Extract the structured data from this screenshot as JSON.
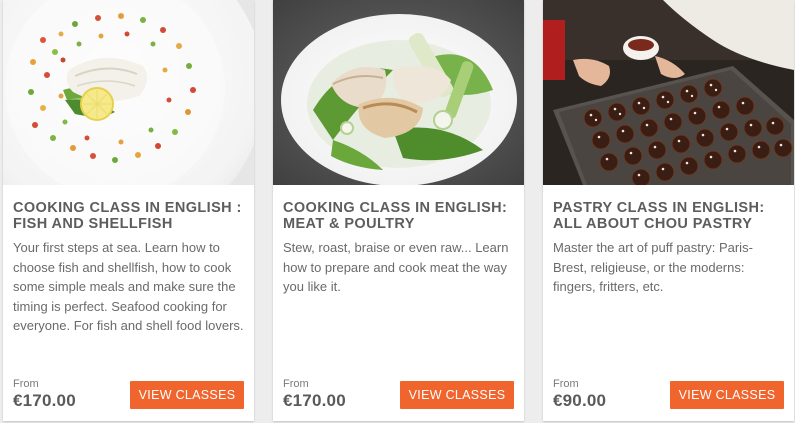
{
  "cards": [
    {
      "image_icon": "fish-dish-photo",
      "title_line1": "COOKING CLASS IN ENGLISH :",
      "title_line2": "FISH AND SHELLFISH",
      "description": "Your first steps at sea. Learn how to choose fish and shellfish, how to cook some simple meals and make sure the timing is perfect. Seafood cooking for everyone. For fish and shell food lovers.",
      "price_label": "From",
      "price": "€170.00",
      "button_label": "VIEW CLASSES"
    },
    {
      "image_icon": "meat-dish-photo",
      "title_line1": "COOKING CLASS IN ENGLISH:",
      "title_line2": "MEAT & POULTRY",
      "description": "Stew, roast, braise or even raw... Learn how to prepare and cook meat the way you like it.",
      "price_label": "From",
      "price": "€170.00",
      "button_label": "VIEW CLASSES"
    },
    {
      "image_icon": "pastry-tray-photo",
      "title_line1": "PASTRY CLASS IN ENGLISH:",
      "title_line2": "ALL ABOUT CHOU PASTRY",
      "description": "Master the art of puff pastry: Paris-Brest, religieuse, or the moderns: fingers, fritters, etc.",
      "price_label": "From",
      "price": "€90.00",
      "button_label": "VIEW CLASSES"
    }
  ],
  "colors": {
    "accent": "#f0642d",
    "title": "#5d5d5d",
    "body_text": "#6a6a6a",
    "background": "#ededed"
  }
}
